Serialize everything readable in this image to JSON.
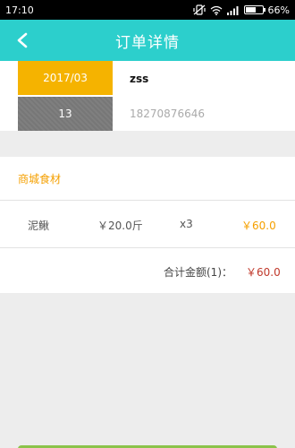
{
  "status_bar": {
    "time": "17:10",
    "battery": "66%",
    "battery_level": 0.66,
    "icons": [
      "vibrate-off-icon",
      "wifi-icon",
      "signal-icon",
      "battery-icon"
    ]
  },
  "header": {
    "title": "订单详情",
    "back_icon": "chevron-left-icon",
    "color": "#2ccfcc"
  },
  "order_info": {
    "month": "2017/03",
    "day": "13",
    "customer_name": "zss",
    "phone": "18270876646",
    "month_color": "#f5b300",
    "day_color": "#777777"
  },
  "section": {
    "title": "商城食材",
    "title_color": "#f5a000"
  },
  "items": [
    {
      "name": "泥鳅",
      "unit_price": "￥20.0斤",
      "quantity": "x3",
      "subtotal": "￥60.0"
    }
  ],
  "total": {
    "label": "合计金额(1)：",
    "amount": "￥60.0",
    "amount_color": "#c0392b"
  },
  "bottom_bar_color": "#8bc34a"
}
